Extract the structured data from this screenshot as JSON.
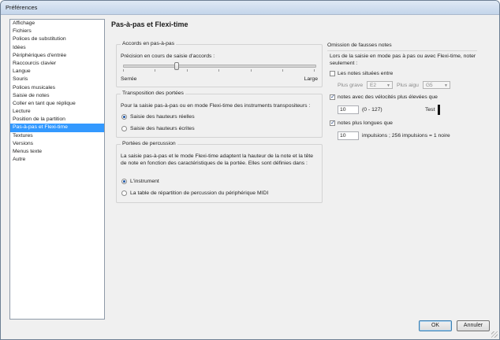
{
  "window": {
    "title": "Préférences"
  },
  "sidebar": {
    "items": [
      {
        "label": "Affichage"
      },
      {
        "label": "Fichiers"
      },
      {
        "label": "Polices de substitution"
      },
      {
        "label": "Idées"
      },
      {
        "label": "Périphériques d'entrée"
      },
      {
        "label": "Raccourcis clavier"
      },
      {
        "label": "Langue"
      },
      {
        "label": "Souris"
      },
      {
        "label": "Polices musicales"
      },
      {
        "label": "Saisie de notes"
      },
      {
        "label": "Coller en tant que réplique"
      },
      {
        "label": "Lecture"
      },
      {
        "label": "Position de la partition"
      },
      {
        "label": "Pas-à-pas et Flexi-time"
      },
      {
        "label": "Textures"
      },
      {
        "label": "Versions"
      },
      {
        "label": "Menus texte"
      },
      {
        "label": "Autre"
      }
    ],
    "selected": "Pas-à-pas et Flexi-time"
  },
  "page": {
    "title": "Pas-à-pas et Flexi-time"
  },
  "accords": {
    "legend": "Accords en pas-à-pas",
    "label": "Précision en cours de saisie d'accords :",
    "min_label": "Serrée",
    "max_label": "Large",
    "slider_fraction": 0.28
  },
  "transposition": {
    "legend": "Transposition des portées",
    "description": "Pour la saisie pas-à-pas ou en mode Flexi-time des instruments transpositeurs :",
    "options": [
      {
        "label": "Saisie des hauteurs réelles",
        "selected": true
      },
      {
        "label": "Saisie des hauteurs écrites",
        "selected": false
      }
    ]
  },
  "percussion": {
    "legend": "Portées de percussion",
    "description": "La saisie pas-à-pas et le mode Flexi-time adaptent la hauteur de la note et la tête de note en fonction des caractéristiques de la portée. Elles sont définies dans :",
    "options": [
      {
        "label": "L'instrument",
        "selected": true
      },
      {
        "label": "La table de répartition de percussion du périphérique MIDI",
        "selected": false
      }
    ]
  },
  "omission": {
    "legend": "Omission de fausses notes",
    "description": "Lors de la saisie en mode pas à pas ou avec Flexi-time, noter seulement :",
    "notes_between": {
      "label": "Les notes situées entre",
      "checked": false
    },
    "plus_grave": {
      "label": "Plus grave",
      "value": "E2"
    },
    "plus_aigu": {
      "label": "Plus aigu",
      "value": "G5"
    },
    "velocity": {
      "label": "notes avec des vélocités plus élevées que",
      "checked": true,
      "value": "10",
      "range": "(0 - 127)",
      "test_label": "Test"
    },
    "longer": {
      "label": "notes plus longues que",
      "checked": true,
      "value": "10",
      "unit": "impulsions ; 256 impulsions = 1 noire"
    }
  },
  "buttons": {
    "ok": "OK",
    "cancel": "Annuler"
  },
  "colors": {
    "selection": "#3399ff",
    "window_bg": "#f0f0f0"
  }
}
